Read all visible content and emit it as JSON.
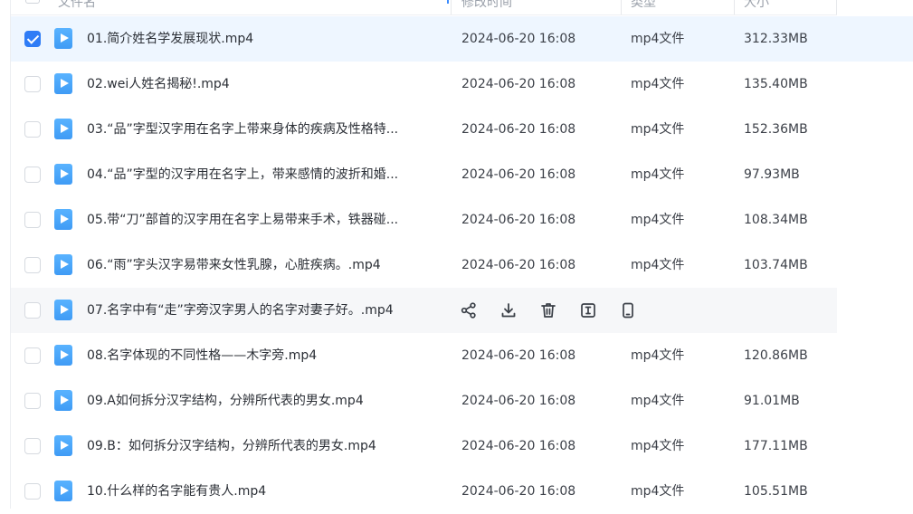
{
  "header": {
    "name_label": "文件名",
    "modified_label": "修改时间",
    "type_label": "类型",
    "size_label": "大小"
  },
  "files": [
    {
      "name": "01.简介姓名学发展现状.mp4",
      "modified": "2024-06-20 16:08",
      "type": "mp4文件",
      "size": "312.33MB",
      "checked": true
    },
    {
      "name": "02.wei人姓名揭秘!.mp4",
      "modified": "2024-06-20 16:08",
      "type": "mp4文件",
      "size": "135.40MB"
    },
    {
      "name": "03.“品”字型汉字用在名字上带来身体的疾病及性格特...",
      "modified": "2024-06-20 16:08",
      "type": "mp4文件",
      "size": "152.36MB"
    },
    {
      "name": "04.“品”字型的汉字用在名字上，带来感情的波折和婚...",
      "modified": "2024-06-20 16:08",
      "type": "mp4文件",
      "size": "97.93MB"
    },
    {
      "name": "05.带“刀”部首的汉字用在名字上易带来手术，铁器碰...",
      "modified": "2024-06-20 16:08",
      "type": "mp4文件",
      "size": "108.34MB"
    },
    {
      "name": "06.“雨”字头汉字易带来女性乳腺，心脏疾病。.mp4",
      "modified": "2024-06-20 16:08",
      "type": "mp4文件",
      "size": "103.74MB"
    },
    {
      "name": "07.名字中有“走”字旁汉字男人的名字对妻子好。.mp4",
      "hovered": true
    },
    {
      "name": "08.名字体现的不同性格——木字旁.mp4",
      "modified": "2024-06-20 16:08",
      "type": "mp4文件",
      "size": "120.86MB"
    },
    {
      "name": "09.A如何拆分汉字结构，分辨所代表的男女.mp4",
      "modified": "2024-06-20 16:08",
      "type": "mp4文件",
      "size": "91.01MB"
    },
    {
      "name": "09.B：如何拆分汉字结构，分辨所代表的男女.mp4",
      "modified": "2024-06-20 16:08",
      "type": "mp4文件",
      "size": "177.11MB"
    },
    {
      "name": "10.什么样的名字能有贵人.mp4",
      "modified": "2024-06-20 16:08",
      "type": "mp4文件",
      "size": "105.51MB"
    }
  ],
  "row_actions": [
    "share-icon",
    "download-icon",
    "delete-icon",
    "rename-icon",
    "phone-icon"
  ],
  "colors": {
    "accent": "#2f7cf6",
    "selected_row": "#eef6ff",
    "hover_row": "#f6f7f9",
    "file_icon": "#4ba6fa"
  }
}
